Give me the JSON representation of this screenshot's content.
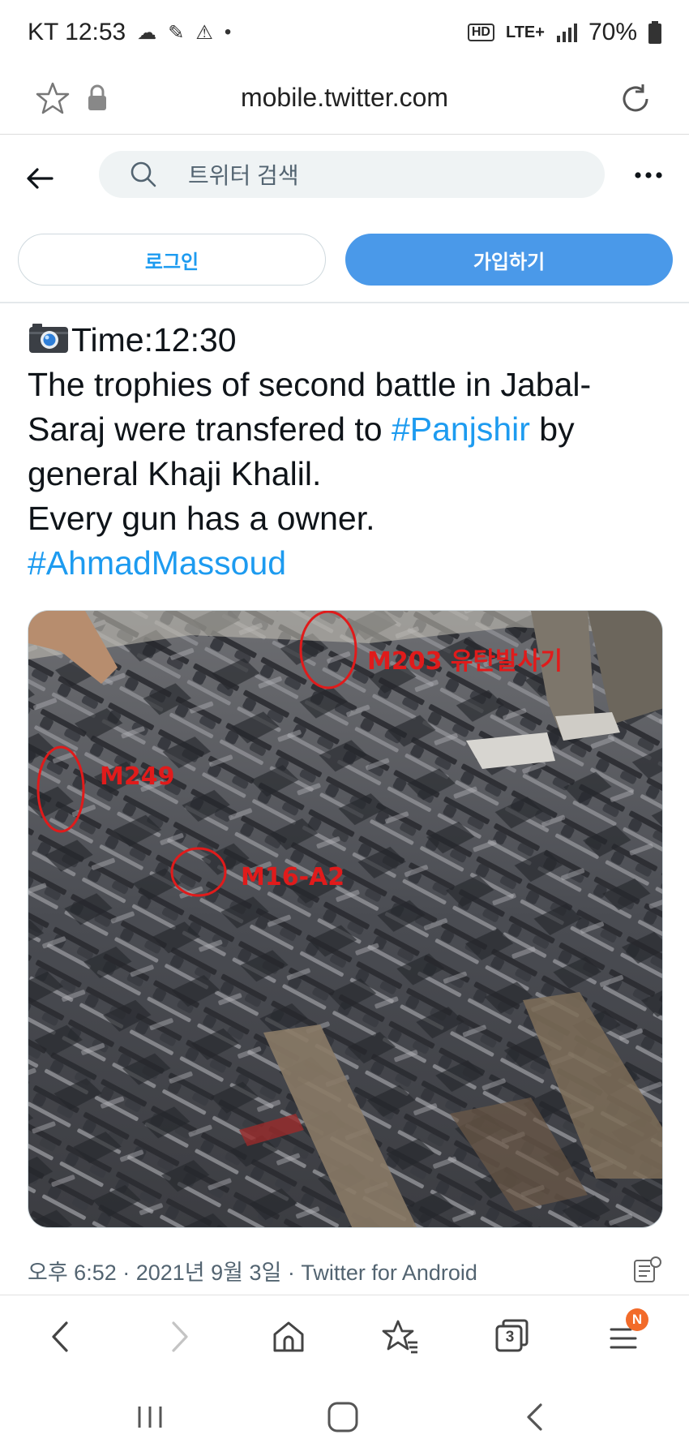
{
  "status_bar": {
    "carrier_time": "KT 12:53",
    "network": "LTE+",
    "hd_badge": "HD",
    "battery": "70%"
  },
  "browser": {
    "url": "mobile.twitter.com"
  },
  "twitter_header": {
    "search_placeholder": "트위터 검색"
  },
  "auth": {
    "login_label": "로그인",
    "signup_label": "가입하기"
  },
  "tweet": {
    "line1": "Time:12:30",
    "line2": "The trophies of second battle in Jabal-",
    "line3_a": "Saraj were transfered to ",
    "line3_hashtag": "#Panjshir",
    "line3_b": " by",
    "line4": "general Khaji Khalil.",
    "line5": "Every gun has a owner.",
    "line6_hashtag": "#AhmadMassoud",
    "timestamp": "오후 6:52 · 2021년 9월 3일 · Twitter for Android"
  },
  "image_annotations": {
    "label_m203": "M203 유탄발사기",
    "label_m249": "M249",
    "label_m16": "M16-A2"
  },
  "bottom_nav": {
    "tabs_count": "3",
    "menu_badge": "N"
  },
  "colors": {
    "accent": "#1d9bf0",
    "signup_bg": "#4a99e9",
    "annotation": "#e01b1b"
  }
}
